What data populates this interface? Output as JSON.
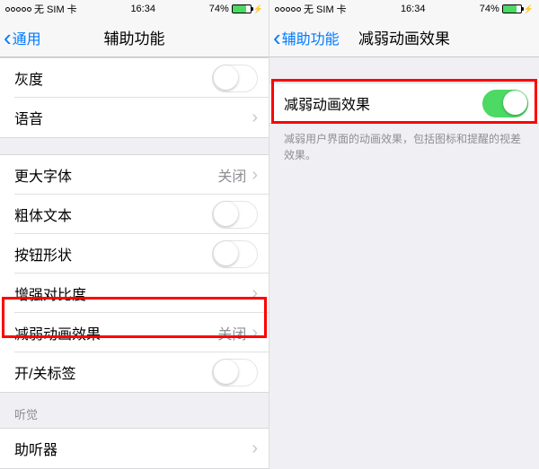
{
  "status": {
    "carrier": "无 SIM 卡",
    "time": "16:34",
    "battery_pct": "74%"
  },
  "left": {
    "nav": {
      "back": "通用",
      "title": "辅助功能"
    },
    "cells": {
      "grayscale": "灰度",
      "voice": "语音",
      "larger_text": "更大字体",
      "larger_text_val": "关闭",
      "bold_text": "粗体文本",
      "button_shapes": "按钮形状",
      "increase_contrast": "增强对比度",
      "reduce_motion": "减弱动画效果",
      "reduce_motion_val": "关闭",
      "on_off_labels": "开/关标签",
      "hearing_header": "听觉",
      "hearing_aids": "助听器"
    }
  },
  "right": {
    "nav": {
      "back": "辅助功能",
      "title": "减弱动画效果"
    },
    "reduce_motion": "减弱动画效果",
    "footnote": "减弱用户界面的动画效果，包括图标和提醒的视差效果。"
  }
}
